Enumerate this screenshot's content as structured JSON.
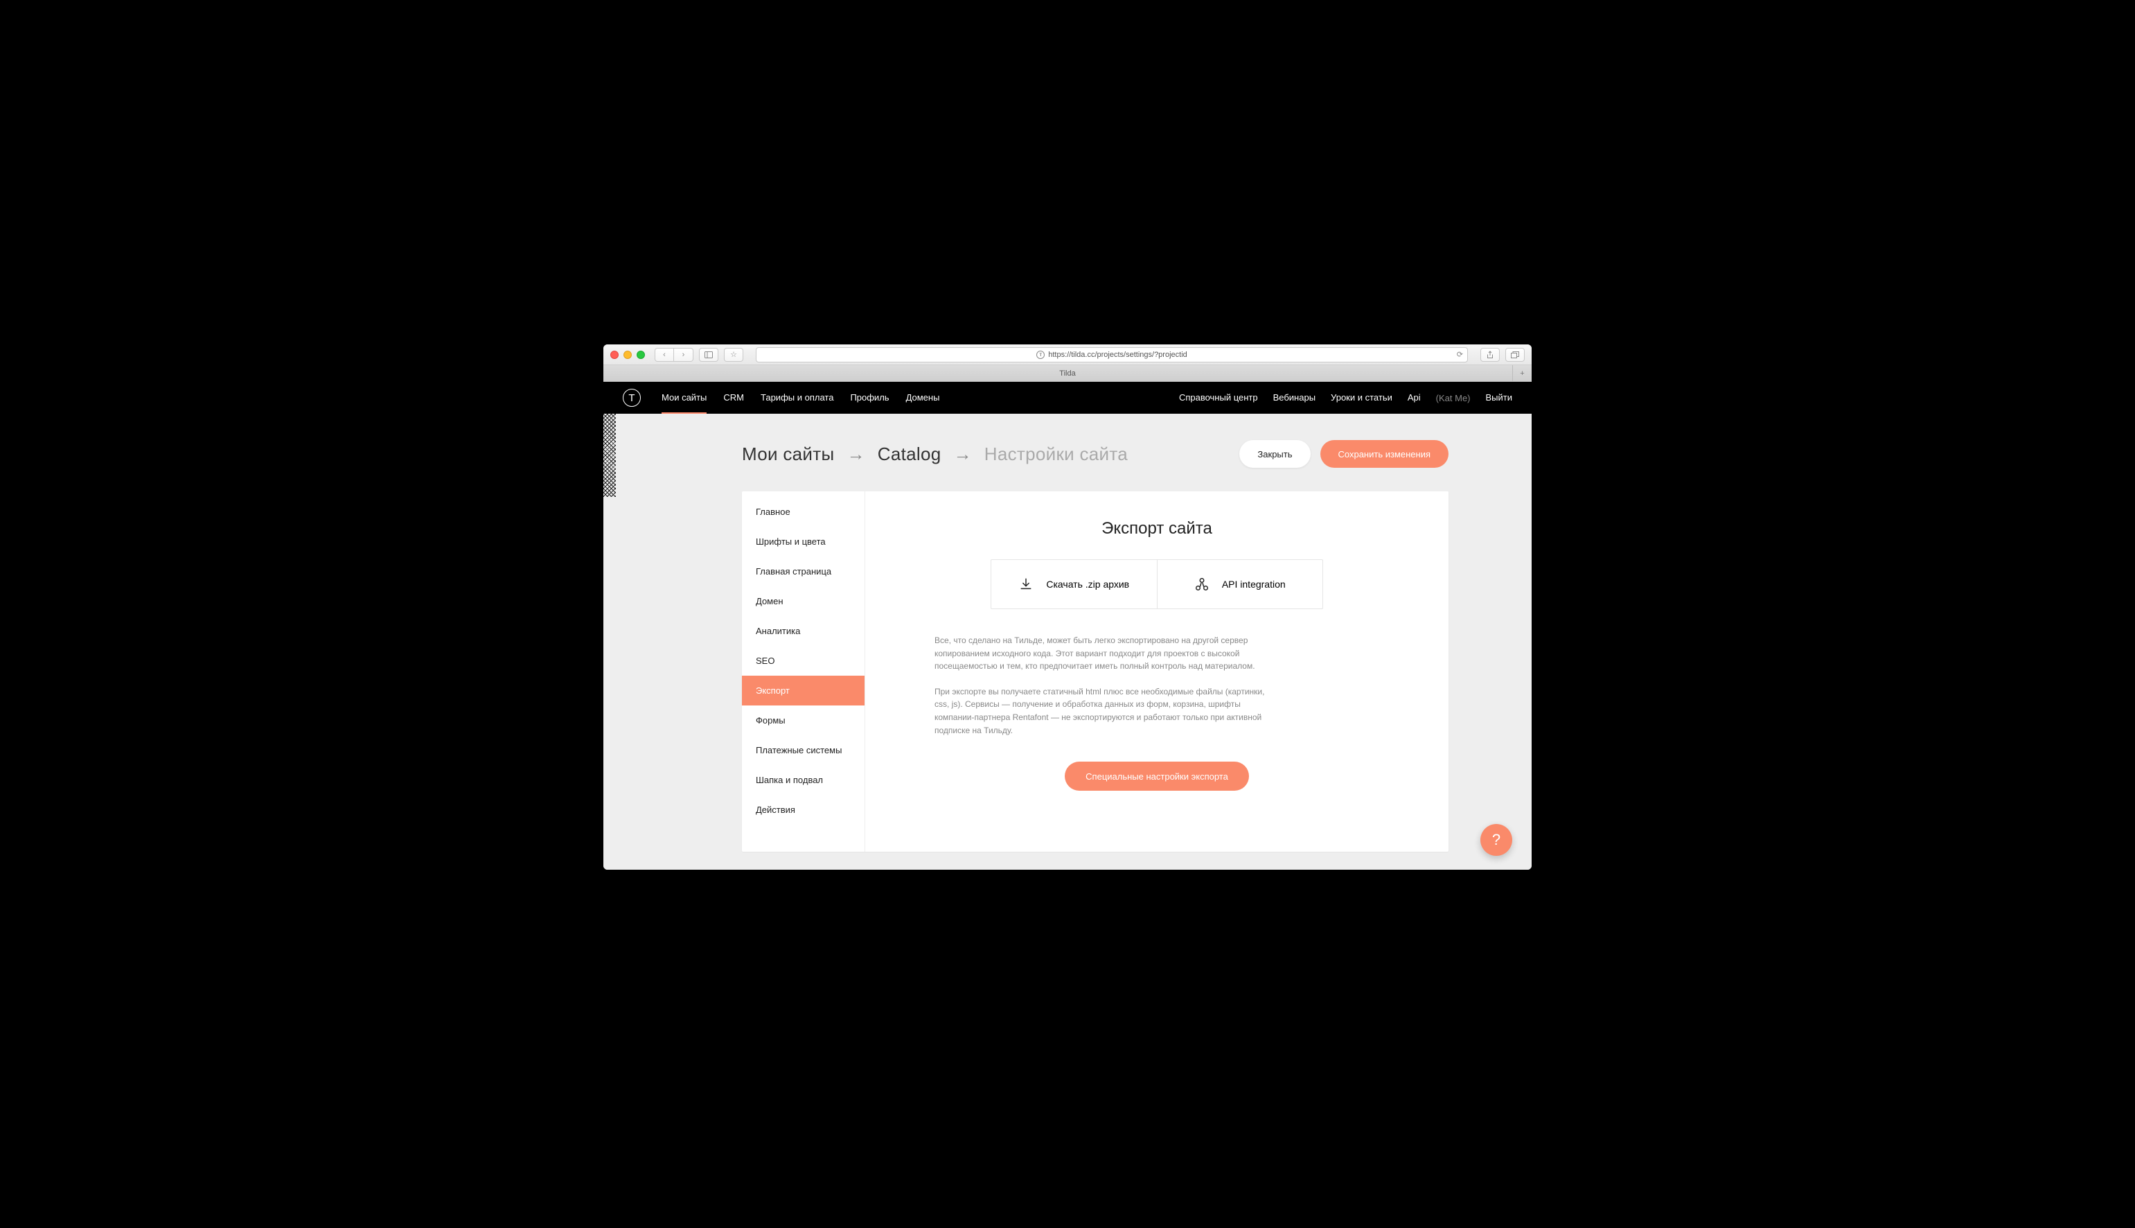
{
  "browser": {
    "url": "https://tilda.cc/projects/settings/?projectid",
    "tab_title": "Tilda"
  },
  "topnav": {
    "left": [
      "Мои сайты",
      "CRM",
      "Тарифы и оплата",
      "Профиль",
      "Домены"
    ],
    "active_index": 0,
    "right": [
      "Справочный центр",
      "Вебинары",
      "Уроки и статьи",
      "Api"
    ],
    "user": "(Kat Me)",
    "logout": "Выйти"
  },
  "breadcrumb": {
    "a": "Мои сайты",
    "b": "Catalog",
    "c": "Настройки сайта"
  },
  "actions": {
    "close": "Закрыть",
    "save": "Сохранить изменения"
  },
  "sidebar": {
    "items": [
      "Главное",
      "Шрифты и цвета",
      "Главная страница",
      "Домен",
      "Аналитика",
      "SEO",
      "Экспорт",
      "Формы",
      "Платежные системы",
      "Шапка и подвал",
      "Действия"
    ],
    "active_index": 6
  },
  "main": {
    "title": "Экспорт сайта",
    "tab_zip": "Скачать .zip архив",
    "tab_api": "API integration",
    "p1": "Все, что сделано на Тильде, может быть легко экспортировано на другой сервер копированием исходного кода. Этот вариант подходит для проектов с высокой посещаемостью и тем, кто предпочитает иметь полный контроль над материалом.",
    "p2": "При экспорте вы получаете статичный html плюс все необходимые файлы (картинки, css, js). Сервисы — получение и обработка данных из форм, корзина, шрифты компании-партнера Rentafont — не экспортируются и работают только при активной подписке на Тильду.",
    "special": "Специальные настройки экспорта"
  },
  "help": "?"
}
